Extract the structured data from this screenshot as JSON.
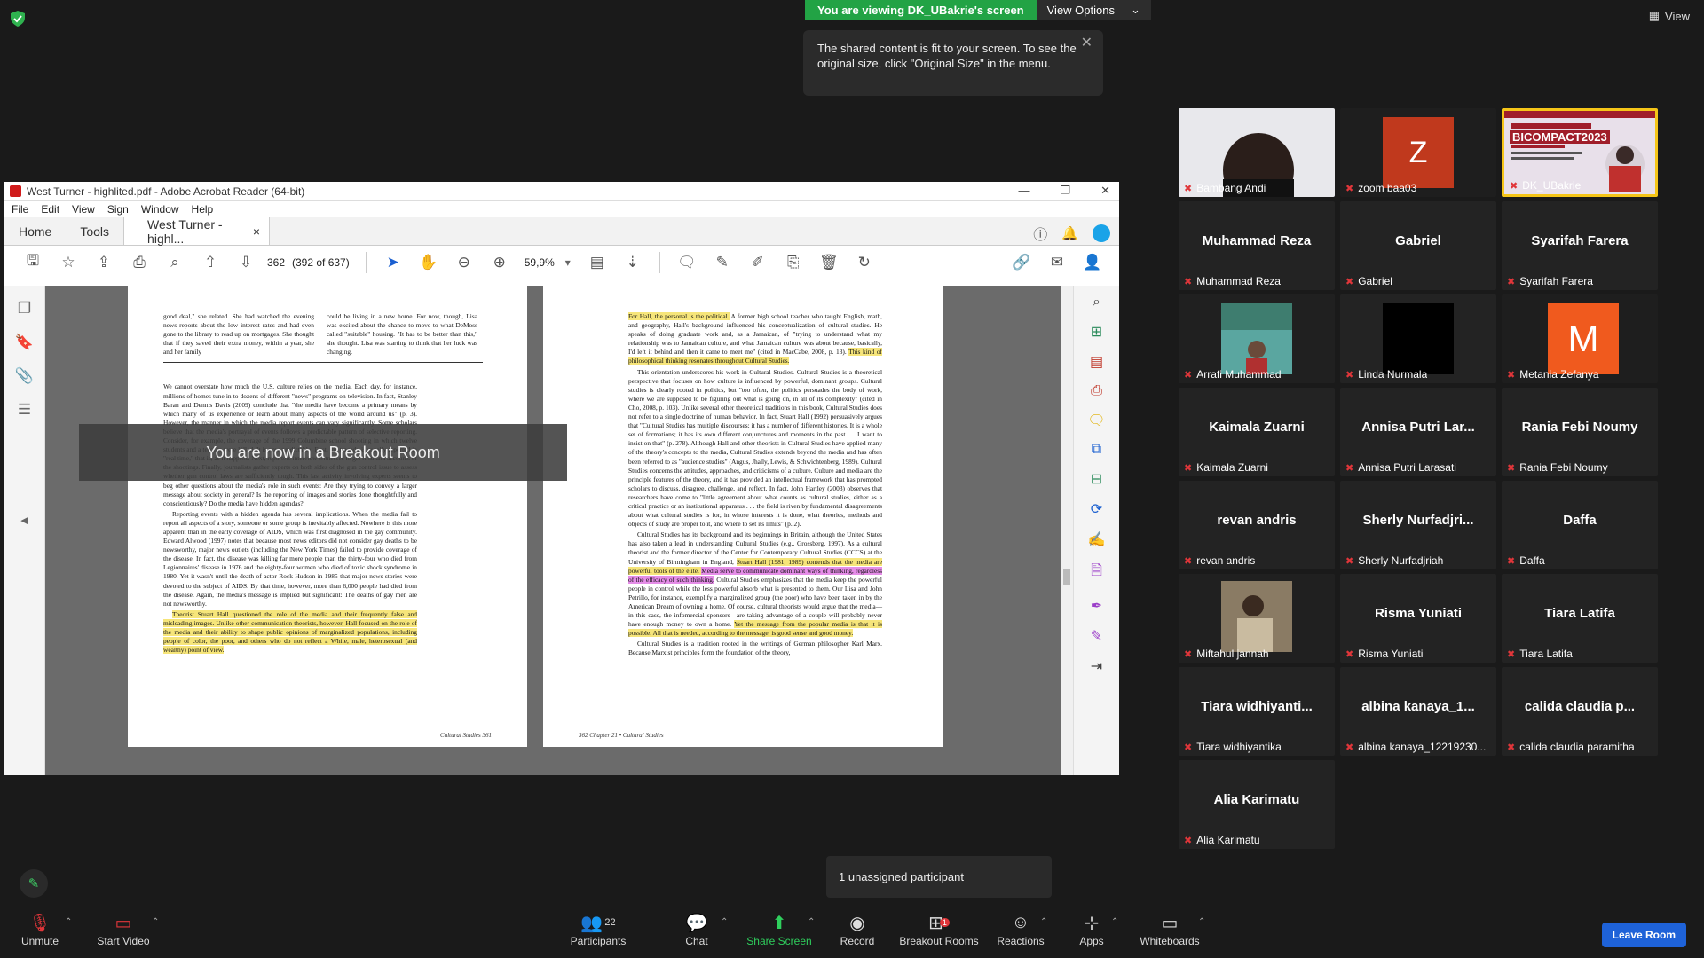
{
  "top": {
    "viewing": "You are viewing DK_UBakrie's screen",
    "view_options": "View Options",
    "view": "View",
    "tooltip": "The shared content is fit to your screen. To see the original size, click \"Original Size\" in the menu."
  },
  "acrobat": {
    "title": "West Turner - highlited.pdf - Adobe Acrobat Reader (64-bit)",
    "menu": [
      "File",
      "Edit",
      "View",
      "Sign",
      "Window",
      "Help"
    ],
    "tabs": {
      "home": "Home",
      "tools": "Tools",
      "doc": "West Turner - highl...",
      "close": "×"
    },
    "page_num": "362",
    "page_info": "(392 of 637)",
    "zoom": "59,9%",
    "overlay": "You are now in a Breakout Room",
    "left_page": {
      "col1": "good deal,\" she related. She had watched the evening news reports about the low interest rates and had even gone to the library to read up on mortgages. She thought that if they saved their extra money, within a year, she and her family",
      "col2": "could be living in a new home. For now, though, Lisa was excited about the chance to move to what DeMoss called \"suitable\" housing. \"It has to be better than this,\" she thought. Lisa was starting to think that her luck was changing.",
      "body1": "We cannot overstate how much the U.S. culture relies on the media. Each day, for instance, millions of homes tune in to dozens of different \"news\" programs on television. In fact, Stanley Baran and Dennis Davis (2009) conclude that \"the media have become a primary means by which many of us experience or learn about many aspects of the world around us\" (p. 3). However, the manner in which the media report events can vary significantly. Some scholars believe that the media's portrayal of events follows a predictable pattern of selective reporting. Consider, for example, the coverage of the 1999 Columbine school shooting in which twelve students and a teacher were killed. It is now predictable: First, the tragedy is usually reported in \"real time,\" that is, as it happens. Next, reporters interview witnesses to get firsthand accounts of the shootings. Finally, journalists gather experts on both sides of the gun control issue to assess whether gun control laws are sufficiently tough. This last activity involving experts seems to beg other questions about the media's role in such events: Are they trying to convey a larger message about society in general? Is the reporting of images and stories done thoughtfully and conscientiously? Do the media have hidden agendas?",
      "body2": "Reporting events with a hidden agenda has several implications. When the media fail to report all aspects of a story, someone or some group is inevitably affected. Nowhere is this more apparent than in the early coverage of AIDS, which was first diagnosed in the gay community. Edward Alwood (1997) notes that because most news editors did not consider gay deaths to be newsworthy, major news outlets (including the New York Times) failed to provide coverage of the disease. In fact, the disease was killing far more people than the thirty-four who died from Legionnaires' disease in 1976 and the eighty-four women who died of toxic shock syndrome in 1980. Yet it wasn't until the death of actor Rock Hudson in 1985 that major news stories were devoted to the subject of AIDS. By that time, however, more than 6,000 people had died from the disease. Again, the media's message is implied but significant: The deaths of gay men are not newsworthy.",
      "body3": "Theorist Stuart Hall questioned the role of the media and their frequently false and misleading images. Unlike other communication theorists, however, Hall focused on the role of the media and their ability to shape public opinions of marginalized populations, including people of color, the poor, and others who do not reflect a White, male, heterosexual (and wealthy) point of view.",
      "footer": "Cultural Studies   361"
    },
    "right_page": {
      "p1_hl": "For Hall, the personal is the political.",
      "p1": " A former high school teacher who taught English, math, and geography, Hall's background influenced his conceptualization of cultural studies. He speaks of doing graduate work and, as a Jamaican, of \"trying to understand what my relationship was to Jamaican culture, and what Jamaican culture was about because, basically, I'd left it behind and then it came to meet me\" (cited in MacCabe, 2008, p. 13). ",
      "p1_hl2": "This kind of philosophical thinking resonates throughout Cultural Studies.",
      "p2": "This orientation underscores his work in Cultural Studies. Cultural Studies is a theoretical perspective that focuses on how culture is influenced by powerful, dominant groups. Cultural studies is clearly rooted in politics, but \"too often, the politics persuades the body of work, where we are supposed to be figuring out what is going on, in all of its complexity\" (cited in Cho, 2008, p. 103). Unlike several other theoretical traditions in this book, Cultural Studies does not refer to a single doctrine of human behavior. In fact, Stuart Hall (1992) persuasively argues that \"Cultural Studies has multiple discourses; it has a number of different histories. It is a whole set of formations; it has its own different conjunctures and moments in the past. . . I want to insist on that\" (p. 278). Although Hall and other theorists in Cultural Studies have applied many of the theory's concepts to the media, Cultural Studies extends beyond the media and has often been referred to as \"audience studies\" (Angus, Jhally, Lewis, & Schwichtenberg, 1989). Cultural Studies concerns the attitudes, approaches, and criticisms of a culture. Culture and media are the principle features of the theory, and it has provided an intellectual framework that has prompted scholars to discuss, disagree, challenge, and reflect. In fact, John Hartley (2003) observes that researchers have come to \"little agreement about what counts as cultural studies, either as a critical practice or an institutional apparatus . . . the field is riven by fundamental disagreements about what cultural studies is for, in whose interests it is done, what theories, methods and objects of study are proper to it, and where to set its limits\" (p. 2).",
      "p3a": "Cultural Studies has its background and its beginnings in Britain, although the United States has also taken a lead in understanding Cultural Studies (e.g., Grossberg, 1997). As a cultural theorist and the former director of the Center for Contemporary Cultural Studies (CCCS) at the University of Birmingham in England, ",
      "p3_hl": "Stuart Hall (1981, 1989) contends that the media are powerful tools of the elite. ",
      "p3_pink": "Media serve to communicate dominant ways of thinking, regardless of the efficacy of such thinking.",
      "p3b": " Cultural Studies emphasizes that the media keep the powerful people in control while the less powerful absorb what is presented to them. Our Lisa and John Petrillo, for instance, exemplify a marginalized group (the poor) who have been taken in by the American Dream of owning a home. Of course, cultural theorists would argue that the media—in this case, the infomercial sponsors—are taking advantage of a couple will probably never have enough money to own a home. ",
      "p3_hl2": "Yet the message from the popular media is that it is possible. All that is needed, according to the message, is good sense and good money.",
      "p4": "Cultural Studies is a tradition rooted in the writings of German philosopher Karl Marx. Because Marxist principles form the foundation of the theory,",
      "footer": "362   Chapter 21 • Cultural Studies"
    }
  },
  "participants": [
    {
      "display": "",
      "label": "Bambang Andi",
      "kind": "video"
    },
    {
      "display": "Z",
      "label": "zoom baa03",
      "kind": "avatar-z"
    },
    {
      "display": "",
      "label": "DK_UBakrie",
      "kind": "screen"
    },
    {
      "display": "Muhammad Reza",
      "label": "Muhammad Reza",
      "kind": "name"
    },
    {
      "display": "Gabriel",
      "label": "Gabriel",
      "kind": "name"
    },
    {
      "display": "Syarifah Farera",
      "label": "Syarifah Farera",
      "kind": "name"
    },
    {
      "display": "",
      "label": "Arrafi Muhammad",
      "kind": "video2"
    },
    {
      "display": "",
      "label": "Linda Nurmala",
      "kind": "black"
    },
    {
      "display": "M",
      "label": "Metania Zefanya",
      "kind": "avatar-m"
    },
    {
      "display": "Kaimala Zuarni",
      "label": "Kaimala Zuarni",
      "kind": "name"
    },
    {
      "display": "Annisa Putri Lar...",
      "label": "Annisa Putri Larasati",
      "kind": "name"
    },
    {
      "display": "Rania Febi Noumy",
      "label": "Rania Febi Noumy",
      "kind": "name"
    },
    {
      "display": "revan andris",
      "label": "revan andris",
      "kind": "name"
    },
    {
      "display": "Sherly  Nurfadjri...",
      "label": "Sherly Nurfadjriah",
      "kind": "name"
    },
    {
      "display": "Daffa",
      "label": "Daffa",
      "kind": "name"
    },
    {
      "display": "",
      "label": "Miftahul jannah",
      "kind": "video3"
    },
    {
      "display": "Risma Yuniati",
      "label": "Risma Yuniati",
      "kind": "name"
    },
    {
      "display": "Tiara Latifa",
      "label": "Tiara Latifa",
      "kind": "name"
    },
    {
      "display": "Tiara  widhiyanti...",
      "label": "Tiara widhiyantika",
      "kind": "name"
    },
    {
      "display": "albina  kanaya_1...",
      "label": "albina kanaya_12219230...",
      "kind": "name"
    },
    {
      "display": "calida  claudia  p...",
      "label": "calida claudia paramitha",
      "kind": "name"
    },
    {
      "display": "Alia Karimatu",
      "label": "Alia Karimatu",
      "kind": "name"
    }
  ],
  "screen_tile": {
    "conf_line": "BICOMPACT2023"
  },
  "unassigned": "1 unassigned participant",
  "bottom": {
    "unmute": "Unmute",
    "start_video": "Start Video",
    "participants": "Participants",
    "participant_count": "22",
    "chat": "Chat",
    "share": "Share Screen",
    "record": "Record",
    "breakout": "Breakout Rooms",
    "breakout_badge": "1",
    "reactions": "Reactions",
    "apps": "Apps",
    "whiteboards": "Whiteboards",
    "leave": "Leave Room"
  }
}
